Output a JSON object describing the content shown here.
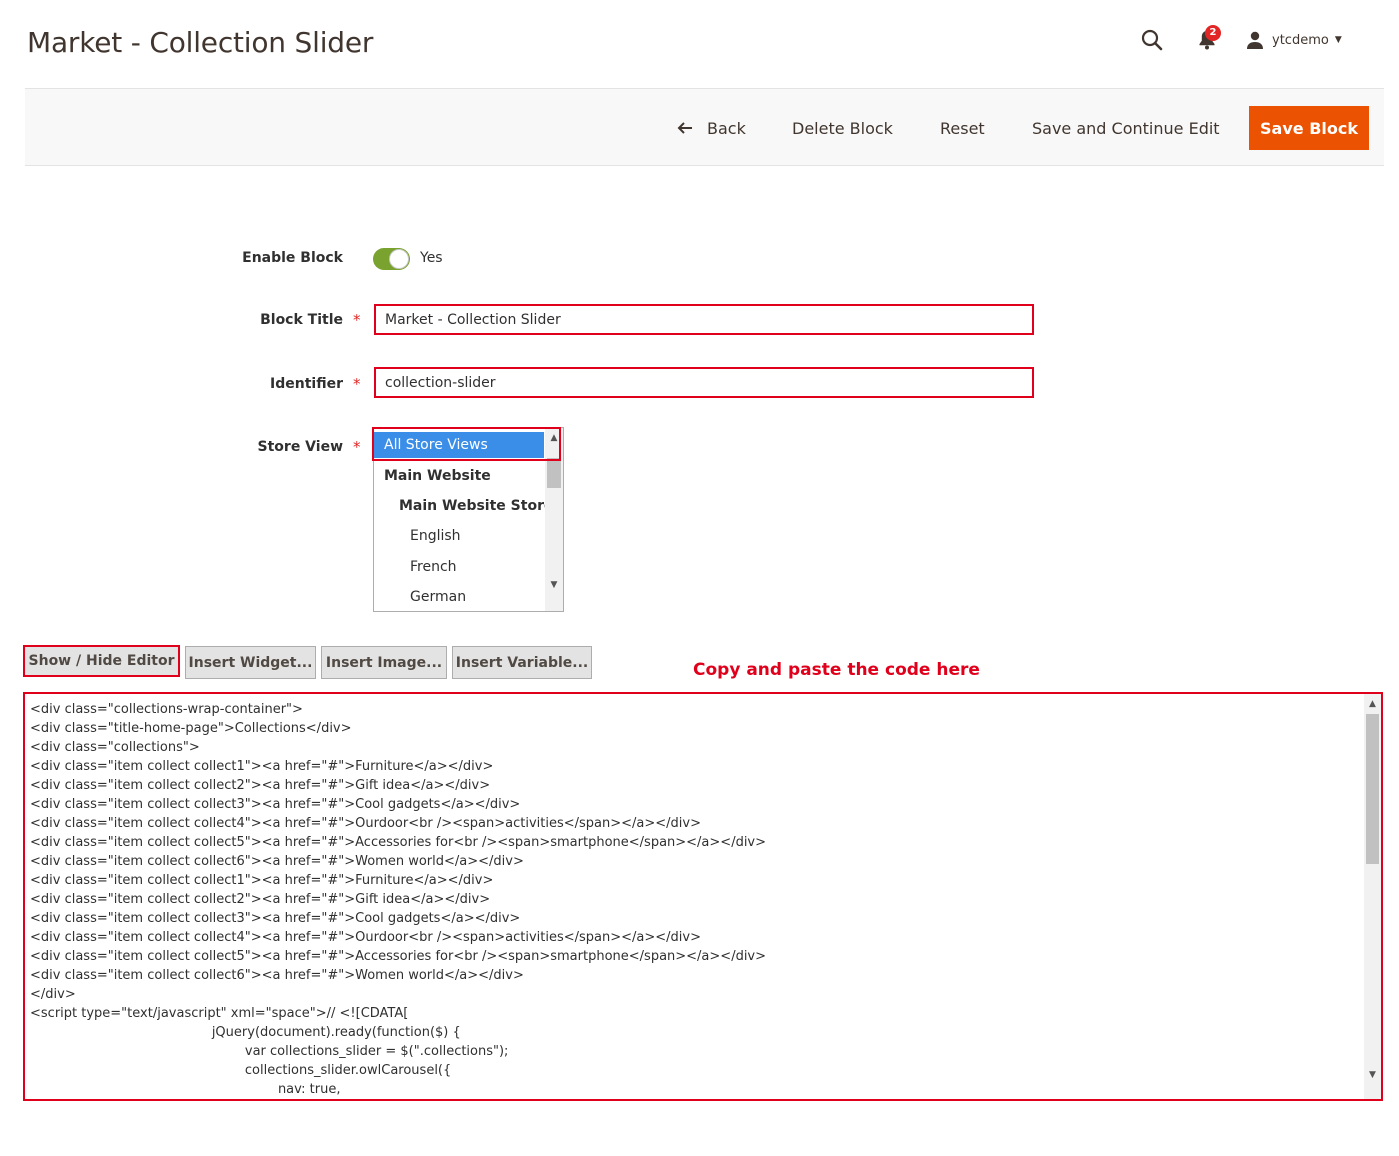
{
  "header": {
    "title": "Market - Collection Slider",
    "notifications_count": "2",
    "username": "ytcdemo",
    "icons": {
      "search": "search-icon",
      "notifications": "bell-icon",
      "user": "user-icon",
      "caret": "caret-down-icon"
    }
  },
  "action_bar": {
    "back_label": "Back",
    "delete_label": "Delete Block",
    "reset_label": "Reset",
    "save_continue_label": "Save and Continue Edit",
    "save_label": "Save Block",
    "accent_color": "#eb5202"
  },
  "form": {
    "enable_block": {
      "label": "Enable Block",
      "value": "Yes",
      "enabled": true
    },
    "block_title": {
      "label": "Block Title",
      "value": "Market - Collection Slider",
      "required_mark": "*"
    },
    "identifier": {
      "label": "Identifier",
      "value": "collection-slider",
      "required_mark": "*"
    },
    "store_view": {
      "label": "Store View",
      "required_mark": "*",
      "options": [
        {
          "label": "All Store Views",
          "selected": true
        },
        {
          "label": "Main Website"
        },
        {
          "label": "Main Website Store"
        },
        {
          "label": "English"
        },
        {
          "label": "French"
        },
        {
          "label": "German"
        }
      ]
    }
  },
  "editor": {
    "show_hide_label": "Show / Hide Editor",
    "insert_widget_label": "Insert Widget...",
    "insert_image_label": "Insert Image...",
    "insert_variable_label": "Insert Variable...",
    "annotation": "Copy and paste the code here",
    "code_lines": [
      "<div class=\"collections-wrap-container\">",
      "<div class=\"title-home-page\">Collections</div>",
      "<div class=\"collections\">",
      "<div class=\"item collect collect1\"><a href=\"#\">Furniture</a></div>",
      "<div class=\"item collect collect2\"><a href=\"#\">Gift idea</a></div>",
      "<div class=\"item collect collect3\"><a href=\"#\">Cool gadgets</a></div>",
      "<div class=\"item collect collect4\"><a href=\"#\">Ourdoor<br /><span>activities</span></a></div>",
      "<div class=\"item collect collect5\"><a href=\"#\">Accessories for<br /><span>smartphone</span></a></div>",
      "<div class=\"item collect collect6\"><a href=\"#\">Women world</a></div>",
      "<div class=\"item collect collect1\"><a href=\"#\">Furniture</a></div>",
      "<div class=\"item collect collect2\"><a href=\"#\">Gift idea</a></div>",
      "<div class=\"item collect collect3\"><a href=\"#\">Cool gadgets</a></div>",
      "<div class=\"item collect collect4\"><a href=\"#\">Ourdoor<br /><span>activities</span></a></div>",
      "<div class=\"item collect collect5\"><a href=\"#\">Accessories for<br /><span>smartphone</span></a></div>",
      "<div class=\"item collect collect6\"><a href=\"#\">Women world</a></div>",
      "</div>",
      "<script type=\"text/javascript\" xml=\"space\">// <![CDATA[",
      "                                            jQuery(document).ready(function($) {",
      "                                                    var collections_slider = $(\".collections\");",
      "                                                    collections_slider.owlCarousel({",
      "                                                            nav: true,"
    ]
  }
}
